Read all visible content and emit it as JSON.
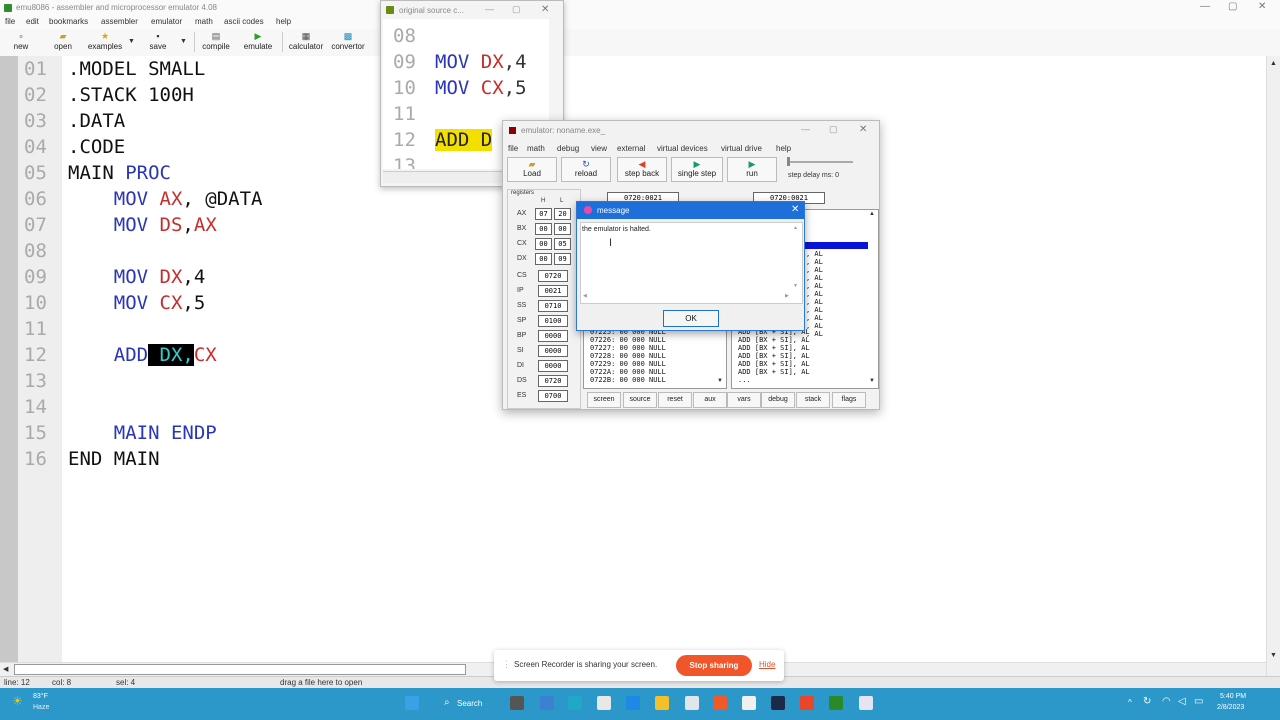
{
  "main_window": {
    "title": "emu8086 - assembler and microprocessor emulator 4.08",
    "menu": [
      "file",
      "edit",
      "bookmarks",
      "assembler",
      "emulator",
      "math",
      "ascii codes",
      "help"
    ],
    "toolbar": {
      "new": "new",
      "open": "open",
      "examples": "examples",
      "save": "save",
      "compile": "compile",
      "emulate": "emulate",
      "calculator": "calculator",
      "convertor": "convertor"
    }
  },
  "editor": {
    "line_numbers": [
      "01",
      "02",
      "03",
      "04",
      "05",
      "06",
      "07",
      "08",
      "09",
      "10",
      "11",
      "12",
      "13",
      "14",
      "15",
      "16"
    ],
    "lines": [
      {
        "a": ".MODEL SMALL",
        "b": "",
        "c": "",
        "d": ""
      },
      {
        "a": ".STACK 100H",
        "b": "",
        "c": "",
        "d": ""
      },
      {
        "a": ".DATA",
        "b": "",
        "c": "",
        "d": ""
      },
      {
        "a": ".CODE",
        "b": "",
        "c": "",
        "d": ""
      },
      {
        "a": "MAIN ",
        "b": "PROC",
        "c": "",
        "d": ""
      },
      {
        "a": "    ",
        "b": "MOV ",
        "c": "AX",
        "d": ", @DATA"
      },
      {
        "a": "    ",
        "b": "MOV ",
        "c": "DS",
        "d": ","
      },
      {
        "a": "",
        "b": "",
        "c": "",
        "d": ""
      },
      {
        "a": "    ",
        "b": "MOV ",
        "c": "DX",
        "d": ",4"
      },
      {
        "a": "    ",
        "b": "MOV ",
        "c": "CX",
        "d": ",5"
      },
      {
        "a": "",
        "b": "",
        "c": "",
        "d": ""
      },
      {
        "a": "    ",
        "b": "ADD",
        "c": "",
        "d": ""
      },
      {
        "a": "",
        "b": "",
        "c": "",
        "d": ""
      },
      {
        "a": "",
        "b": "",
        "c": "",
        "d": ""
      },
      {
        "a": "    ",
        "b": "MAIN ENDP",
        "c": "",
        "d": ""
      },
      {
        "a": "END MAIN",
        "b": "",
        "c": "",
        "d": ""
      }
    ],
    "line7_tail": "AX",
    "line12_selected": " DX,",
    "line12_tail": "CX"
  },
  "status": {
    "line": "line: 12",
    "col": "col: 8",
    "sel": "sel: 4",
    "hint": "drag a file here to open"
  },
  "source_window": {
    "title": "original source c...",
    "line_numbers": [
      "08",
      "09",
      "10",
      "11",
      "12",
      "13"
    ],
    "line09_kw": "MOV ",
    "line09_reg": "DX",
    "line09_rest": ",4",
    "line10_kw": "MOV ",
    "line10_reg": "CX",
    "line10_rest": ",5",
    "line12": "ADD D"
  },
  "emulator": {
    "title": "emulator: noname.exe_",
    "menu": [
      "file",
      "math",
      "debug",
      "view",
      "external",
      "virtual devices",
      "virtual drive",
      "help"
    ],
    "buttons": {
      "load": "Load",
      "reload": "reload",
      "step_back": "step back",
      "single_step": "single step",
      "run": "run"
    },
    "step_delay": "step delay ms: 0",
    "addr1": "0720:0021",
    "addr2": "0720:0021",
    "registers_label": "registers",
    "h_label": "H",
    "l_label": "L",
    "regs": [
      {
        "name": "AX",
        "h": "07",
        "l": "20"
      },
      {
        "name": "BX",
        "h": "00",
        "l": "00"
      },
      {
        "name": "CX",
        "h": "00",
        "l": "05"
      },
      {
        "name": "DX",
        "h": "00",
        "l": "09"
      }
    ],
    "seg_regs": [
      {
        "name": "CS",
        "v": "0720"
      },
      {
        "name": "IP",
        "v": "0021"
      },
      {
        "name": "SS",
        "v": "0710"
      },
      {
        "name": "SP",
        "v": "0100"
      },
      {
        "name": "BP",
        "v": "0000"
      },
      {
        "name": "SI",
        "v": "0000"
      },
      {
        "name": "DI",
        "v": "0000"
      },
      {
        "name": "DS",
        "v": "0720"
      },
      {
        "name": "ES",
        "v": "0700"
      }
    ],
    "memory_lines": [
      "07225: 00 000 NULL",
      "07226: 00 000 NULL",
      "07227: 00 000 NULL",
      "07228: 00 000 NULL",
      "07229: 00 000 NULL",
      "0722A: 00 000 NULL",
      "0722B: 00 000 NULL"
    ],
    "disasm_lines": [
      ", AL",
      ", AL",
      ", AL",
      ", AL",
      ", AL",
      ", AL",
      ", AL",
      ", AL",
      ", AL",
      ", AL",
      ", AL"
    ],
    "disasm_lower": [
      "ADD [BX + SI], AL",
      "ADD [BX + SI], AL",
      "ADD [BX + SI], AL",
      "ADD [BX + SI], AL",
      "ADD [BX + SI], AL",
      "ADD [BX + SI], AL",
      "..."
    ],
    "bottom_buttons": [
      "screen",
      "source",
      "reset",
      "aux",
      "vars",
      "debug",
      "stack",
      "flags"
    ]
  },
  "message_box": {
    "title": "message",
    "text": "the emulator is halted.",
    "ok": "OK"
  },
  "share_notice": {
    "text": "Screen Recorder is sharing your screen.",
    "stop": "Stop sharing",
    "hide": "Hide"
  },
  "taskbar": {
    "temp": "83°F",
    "weather": "Haze",
    "search": "Search",
    "time": "5:40 PM",
    "date": "2/8/2023"
  },
  "colors": {
    "keyword": "#2a35b8",
    "register": "#c82d2d",
    "taskbar": "#2b98c9",
    "stop_button": "#f0562a",
    "msg_title": "#1e6fd9"
  }
}
